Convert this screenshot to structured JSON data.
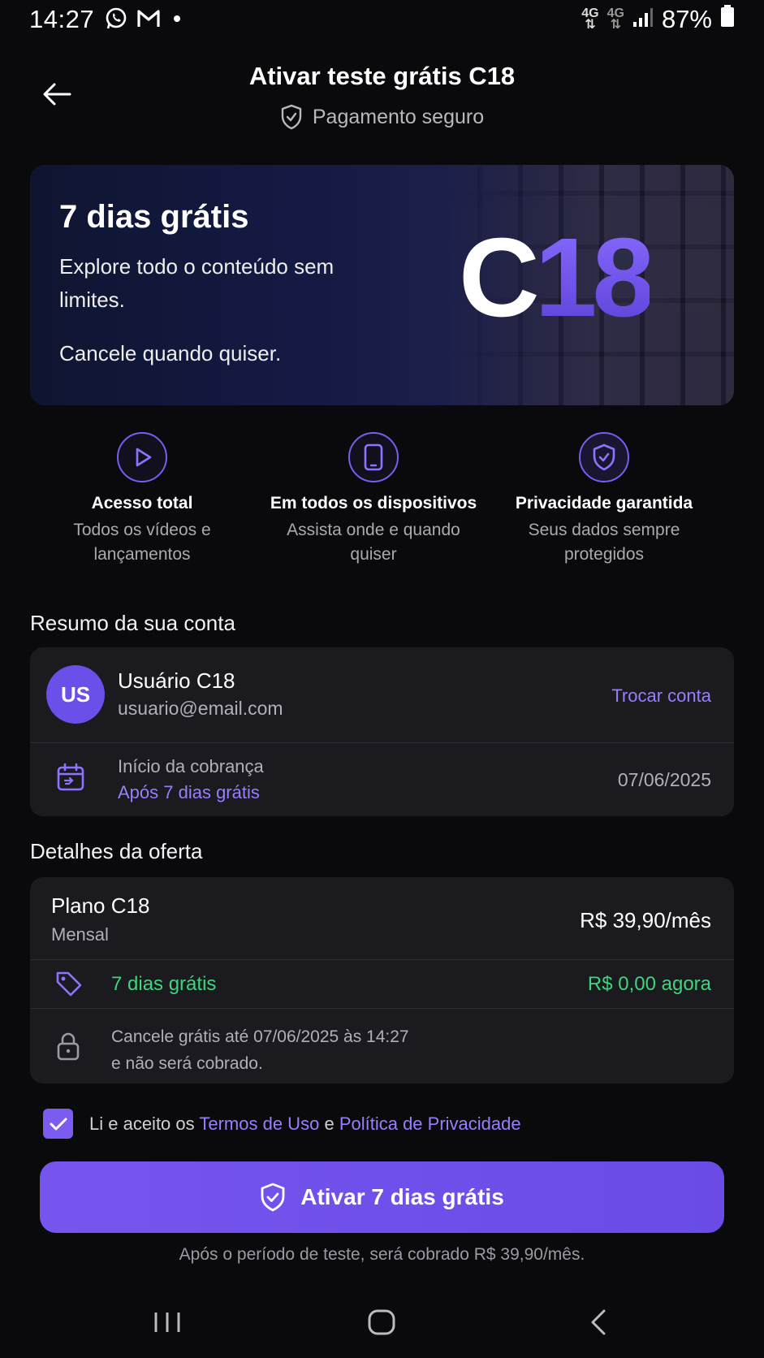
{
  "status_bar": {
    "time": "14:27",
    "notification_icons": [
      "whatsapp-icon",
      "gmail-icon",
      "dot-icon"
    ],
    "network_1": "4G",
    "network_2": "4G",
    "battery": "87%"
  },
  "header": {
    "title": "Ativar teste grátis C18",
    "subtitle": "Pagamento seguro"
  },
  "hero": {
    "title": "7 dias grátis",
    "description": "Explore todo o conteúdo sem limites.",
    "cancel_text": "Cancele quando quiser.",
    "logo_letter": "C",
    "logo_number": "18"
  },
  "features": [
    {
      "icon": "play-icon",
      "title": "Acesso total",
      "desc": "Todos os vídeos e lançamentos"
    },
    {
      "icon": "phone-icon",
      "title": "Em todos os dispositivos",
      "desc": "Assista onde e quando quiser"
    },
    {
      "icon": "shield-check-icon",
      "title": "Privacidade garantida",
      "desc": "Seus dados sempre protegidos"
    }
  ],
  "account": {
    "section_title": "Resumo da sua conta",
    "avatar_initials": "US",
    "name": "Usuário C18",
    "email": "usuario@email.com",
    "switch_label": "Trocar conta",
    "billing_label": "Início da cobrança",
    "billing_sub": "Após 7 dias grátis",
    "billing_date": "07/06/2025"
  },
  "offer": {
    "section_title": "Detalhes da oferta",
    "plan_name": "Plano C18",
    "plan_period": "Mensal",
    "plan_price": "R$ 39,90/mês",
    "trial_label": "7 dias grátis",
    "trial_price": "R$ 0,00 agora",
    "cancel_line1": "Cancele grátis até 07/06/2025 às 14:27",
    "cancel_line2": "e não será cobrado."
  },
  "terms": {
    "checked": true,
    "prefix": "Li e aceito os",
    "terms_link": "Termos de Uso",
    "conjunction": "e",
    "privacy_link": "Política de Privacidade"
  },
  "cta": {
    "label": "Ativar 7 dias grátis"
  },
  "footer_note": "Após o período de teste, será cobrado R$ 39,90/mês.",
  "colors": {
    "background": "#0a0a0d",
    "accent": "#7b5cf0",
    "success": "#3dd67a",
    "card": "#1a1a1f"
  }
}
